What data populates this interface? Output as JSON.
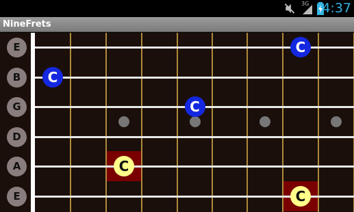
{
  "status_bar": {
    "time": "4:37",
    "icons": [
      "mute-icon",
      "signal-3g-icon",
      "battery-charging-icon"
    ],
    "network_label": "3G"
  },
  "app": {
    "title": "NineFrets"
  },
  "fretboard": {
    "strings": [
      "E",
      "B",
      "G",
      "D",
      "A",
      "E"
    ],
    "fret_count": 9,
    "inlay_frets": [
      3,
      5,
      7,
      9
    ],
    "notes": [
      {
        "string": 1,
        "fret": 8,
        "name": "C",
        "style": "blue"
      },
      {
        "string": 2,
        "fret": 1,
        "name": "C",
        "style": "blue"
      },
      {
        "string": 3,
        "fret": 5,
        "name": "C",
        "style": "blue"
      },
      {
        "string": 5,
        "fret": 3,
        "name": "C",
        "style": "yellow",
        "highlighted": true
      },
      {
        "string": 6,
        "fret": 8,
        "name": "C",
        "style": "yellow",
        "highlighted": true
      }
    ]
  },
  "colors": {
    "note_blue": "#1428e0",
    "note_yellow": "#ffff8a",
    "highlight": "#7a0000",
    "fret": "#b08a3a",
    "board": "#1a0f0a",
    "clock": "#33b5e5"
  }
}
